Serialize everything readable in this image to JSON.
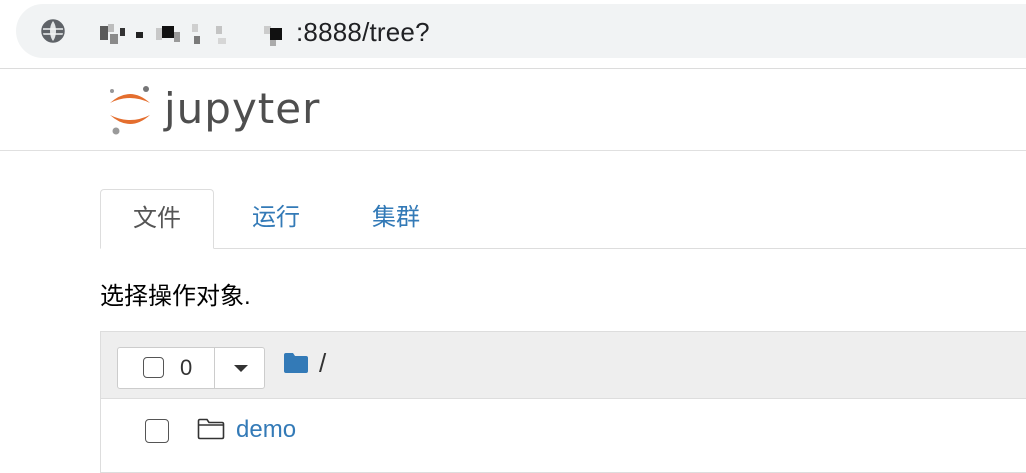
{
  "browser": {
    "url_suffix": ":8888/tree?"
  },
  "header": {
    "logo_text": "jupyter"
  },
  "tabs": [
    {
      "label": "文件",
      "active": true
    },
    {
      "label": "运行",
      "active": false
    },
    {
      "label": "集群",
      "active": false
    }
  ],
  "instructions": "选择操作对象.",
  "list_header": {
    "selected_count": "0",
    "breadcrumb_sep": "/"
  },
  "items": [
    {
      "name": "demo",
      "type": "folder"
    }
  ],
  "colors": {
    "link": "#337ab7",
    "logo_orange": "#e46e2e",
    "header_bg": "#eeeeee"
  },
  "icons": [
    "globe-icon",
    "folder-filled-icon",
    "folder-outline-icon",
    "caret-down-icon"
  ]
}
